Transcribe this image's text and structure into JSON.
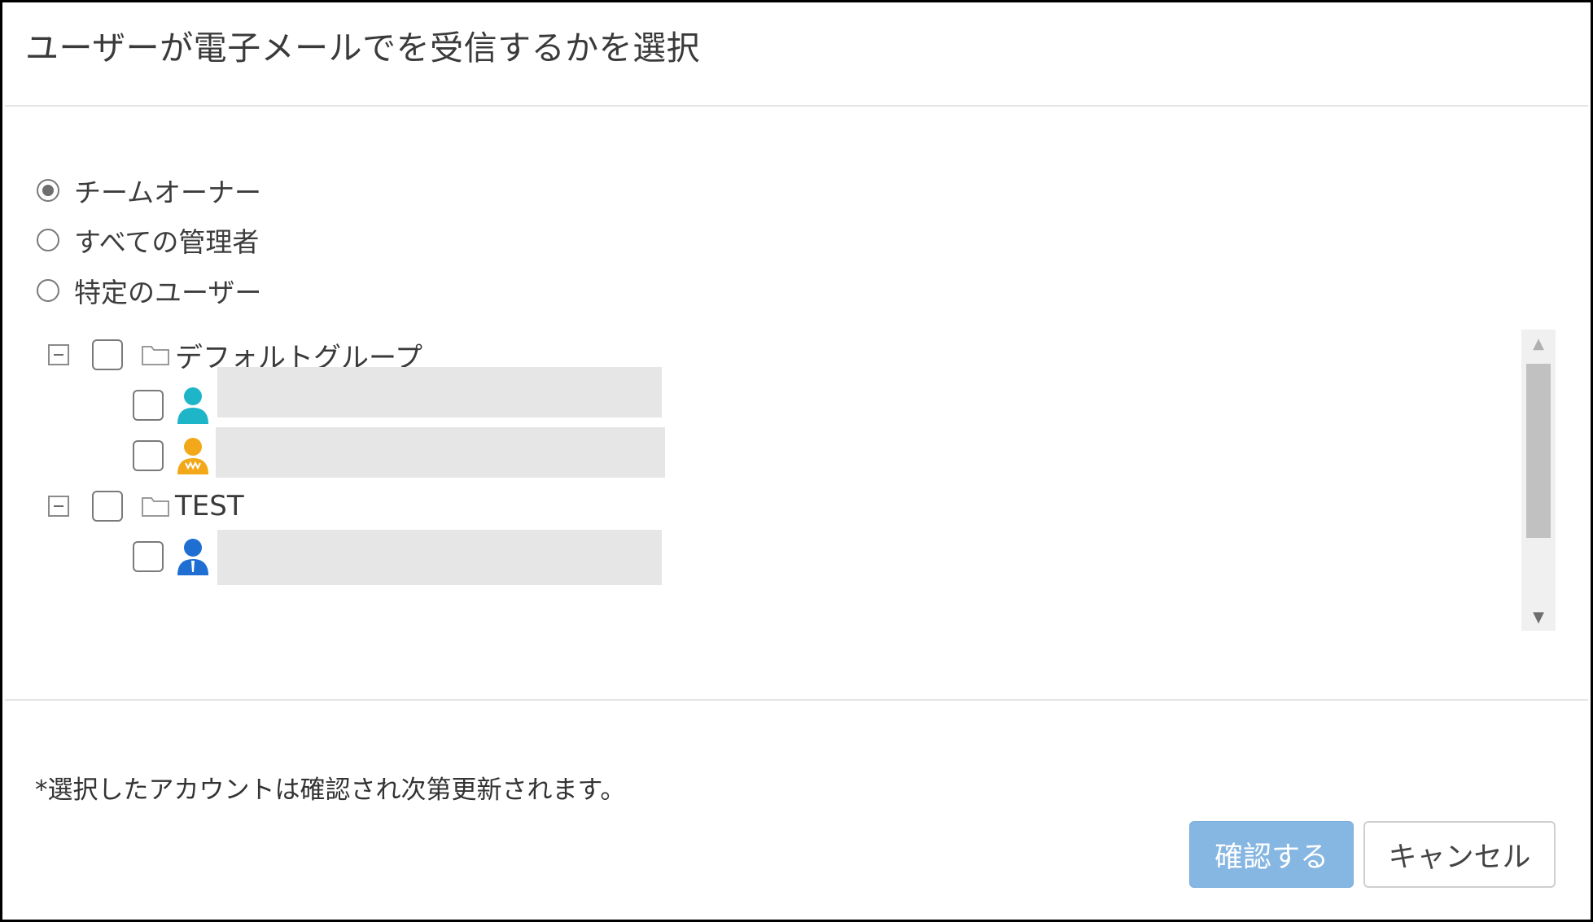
{
  "dialog": {
    "title": "ユーザーが電子メールでを受信するかを選択"
  },
  "recipient_options": [
    {
      "label": "チームオーナー",
      "selected": true
    },
    {
      "label": "すべての管理者",
      "selected": false
    },
    {
      "label": "特定のユーザー",
      "selected": false
    }
  ],
  "tree": {
    "groups": [
      {
        "label": "デフォルトグループ",
        "expanded": true,
        "checked": false,
        "users": [
          {
            "icon": "user-cyan-icon",
            "checked": false,
            "name_redacted": true
          },
          {
            "icon": "user-orange-icon",
            "checked": false,
            "name_redacted": true
          }
        ]
      },
      {
        "label": "TEST",
        "expanded": true,
        "checked": false,
        "users": [
          {
            "icon": "user-blue-icon",
            "checked": false,
            "name_redacted": true
          }
        ]
      }
    ]
  },
  "footer": {
    "note": "*選択したアカウントは確認され次第更新されます。",
    "confirm_label": "確認する",
    "cancel_label": "キャンセル"
  },
  "colors": {
    "confirm_bg": "#86b6e2",
    "user_cyan": "#1fb5c9",
    "user_orange": "#f2a818",
    "user_blue": "#1e6fd1",
    "redaction": "#e6e6e6"
  }
}
